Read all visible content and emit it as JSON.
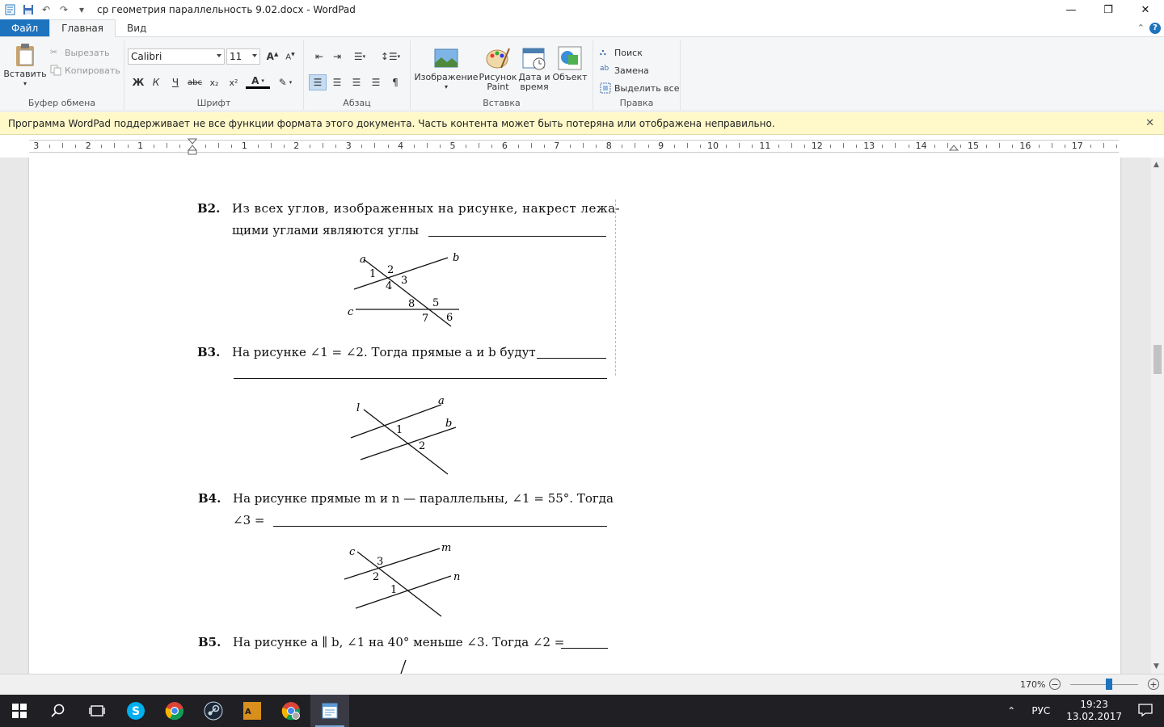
{
  "window": {
    "title": "ср геометрия параллельность 9.02.docx - WordPad"
  },
  "tabs": [
    {
      "label": "Файл"
    },
    {
      "label": "Главная"
    },
    {
      "label": "Вид"
    }
  ],
  "ribbon": {
    "clipboard": {
      "paste": "Вставить",
      "cut": "Вырезать",
      "copy": "Копировать",
      "group_label": "Буфер обмена"
    },
    "font": {
      "font_name": "Calibri",
      "font_size": "11",
      "group_label": "Шрифт",
      "bold": "Ж",
      "italic": "К",
      "underline": "Ч",
      "strike": "abc",
      "subscript": "x₂",
      "superscript": "x²",
      "font_color": "A"
    },
    "paragraph": {
      "group_label": "Абзац"
    },
    "insert": {
      "picture": "Изображение",
      "paint_line1": "Рисунок",
      "paint_line2": "Paint",
      "datetime_line1": "Дата и",
      "datetime_line2": "время",
      "object": "Объект",
      "group_label": "Вставка"
    },
    "editing": {
      "find": "Поиск",
      "replace": "Замена",
      "select_all": "Выделить все",
      "group_label": "Правка"
    }
  },
  "infobar": {
    "message": "Программа WordPad поддерживает не все функции формата этого документа. Часть контента может быть потеряна или отображена неправильно."
  },
  "ruler": {
    "labels": [
      "3",
      "2",
      "1",
      "1",
      "2",
      "3",
      "4",
      "5",
      "6",
      "7",
      "8",
      "9",
      "10",
      "11",
      "12",
      "13",
      "14",
      "15",
      "16",
      "17"
    ]
  },
  "document": {
    "b2": {
      "label": "В2.",
      "line1": "Из всех углов, изображенных на рисунке, накрест лежа-",
      "line2": "щими углами являются углы",
      "fig": {
        "a": "a",
        "b": "b",
        "c": "c",
        "n1": "1",
        "n2": "2",
        "n3": "3",
        "n4": "4",
        "n5": "5",
        "n6": "6",
        "n7": "7",
        "n8": "8"
      }
    },
    "b3": {
      "label": "В3.",
      "line1": "На рисунке ∠1 = ∠2. Тогда прямые a и b будут",
      "fig": {
        "l": "l",
        "a": "a",
        "b": "b",
        "n1": "1",
        "n2": "2"
      }
    },
    "b4": {
      "label": "В4.",
      "line1": "На рисунке прямые m и n — параллельны, ∠1 = 55°. Тогда",
      "line2": "∠3 =",
      "fig": {
        "c": "c",
        "m": "m",
        "n": "n",
        "n1": "1",
        "n2": "2",
        "n3": "3"
      }
    },
    "b5": {
      "label": "В5.",
      "line1": "На рисунке a ∥ b, ∠1 на 40° меньше ∠3. Тогда ∠2 ="
    }
  },
  "statusbar": {
    "zoom": "170%",
    "zoom_value": 0.53
  },
  "taskbar": {
    "lang": "РУС",
    "time": "19:23",
    "date": "13.02.2017"
  }
}
